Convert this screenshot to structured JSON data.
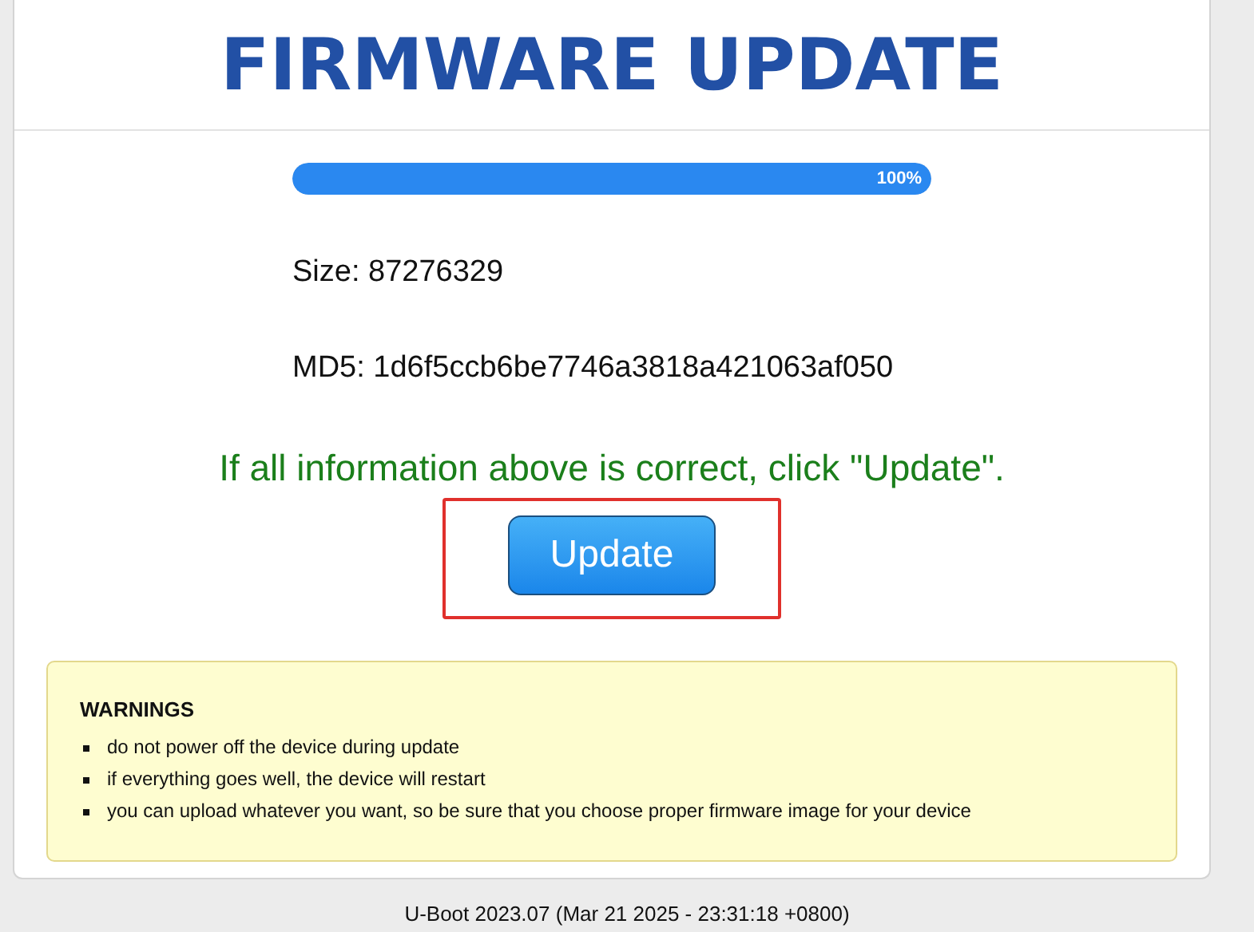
{
  "title": "FIRMWARE UPDATE",
  "progress": {
    "level": 1,
    "reading": "100%"
  },
  "info": [
    "Size: 87276329",
    "MD5: 1d6f5ccb6be7746a3818a421063af050"
  ],
  "message": "If all information above is correct, click \"Update\".",
  "button": {
    "label": "Update",
    "highlighted": true
  },
  "warnings": {
    "title": "WARNINGS",
    "items": [
      "do not power off the device during update",
      "if everything goes well, the device will restart",
      "you can upload whatever you want, so be sure that you choose proper firmware image for your device"
    ]
  },
  "footer": "U-Boot 2023.07 (Mar 21 2025 - 23:31:18 +0800)"
}
